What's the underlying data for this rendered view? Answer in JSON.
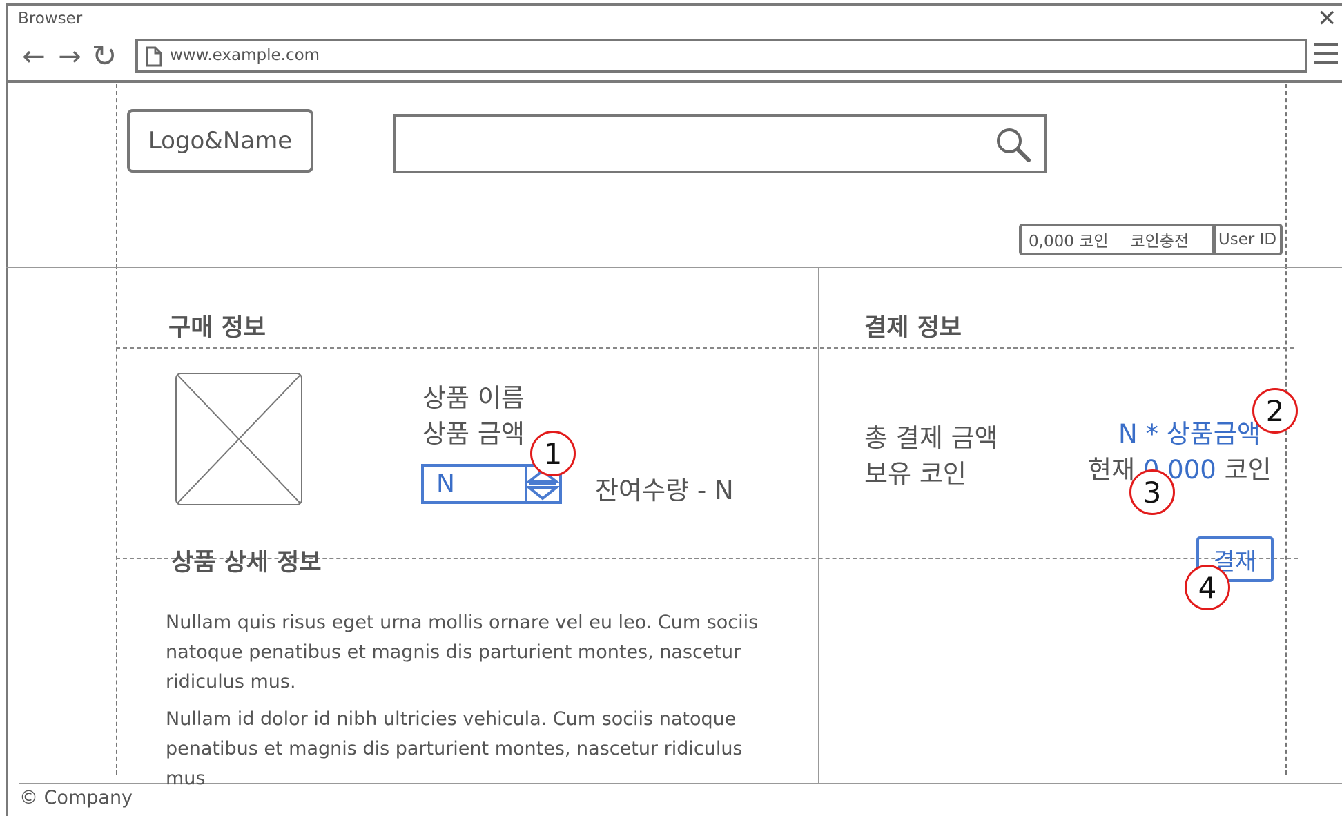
{
  "browser": {
    "title": "Browser",
    "close_glyph": "✕",
    "back_glyph": "←",
    "forward_glyph": "→",
    "reload_glyph": "↻",
    "url": "www.example.com"
  },
  "header": {
    "logo": "Logo&Name",
    "search": {
      "value": "",
      "placeholder": ""
    }
  },
  "userbar": {
    "coin_amount": "0,000 코인",
    "coin_charge": "코인충전",
    "user_id": "User ID"
  },
  "purchase": {
    "title": "구매 정보",
    "product_name": "상품 이름",
    "product_price": "상품 금액",
    "quantity": "N",
    "stock": "잔여수량 - N"
  },
  "payment": {
    "title": "결제 정보",
    "total_label": "총 결제 금액",
    "total_value": "N * 상품금액",
    "owned_label": "보유 코인",
    "current_prefix": "현재",
    "current_value": "0,000",
    "current_suffix": "코인",
    "pay_button": "결재"
  },
  "details": {
    "title": "상품 상세 정보",
    "paragraphs": [
      "Nullam quis risus eget urna mollis ornare vel eu leo. Cum sociis natoque penatibus et magnis dis parturient montes, nascetur ridiculus mus.",
      "Nullam id dolor id nibh ultricies vehicula. Cum sociis natoque penatibus et magnis dis parturient montes, nascetur ridiculus mus"
    ]
  },
  "annotations": [
    "1",
    "2",
    "3",
    "4"
  ],
  "footer": "© Company",
  "colors": {
    "accent_blue": "#3a6ec8",
    "marker_red": "#e21b1b",
    "wire_gray": "#777777"
  }
}
